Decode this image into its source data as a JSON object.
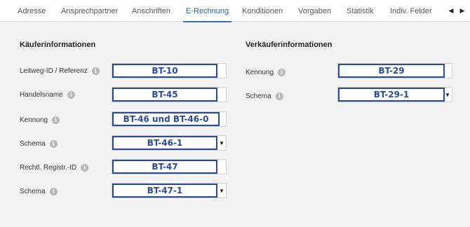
{
  "tabs": [
    {
      "label": "Adresse",
      "active": false
    },
    {
      "label": "Ansprechpartner",
      "active": false
    },
    {
      "label": "Anschriften",
      "active": false
    },
    {
      "label": "E-Rechnung",
      "active": true
    },
    {
      "label": "Konditionen",
      "active": false
    },
    {
      "label": "Vorgaben",
      "active": false
    },
    {
      "label": "Statistik",
      "active": false
    },
    {
      "label": "Indiv. Felder",
      "active": false
    }
  ],
  "tab_scroll": {
    "left": "◀",
    "right": "▶"
  },
  "buyer": {
    "title": "Käuferinformationen",
    "fields": [
      {
        "label": "Leitweg-ID / Referenz",
        "value": "BT-10",
        "type": "text"
      },
      {
        "label": "Handelsname",
        "value": "BT-45",
        "type": "text"
      },
      {
        "label": "Kennung",
        "value": "BT-46 und BT-46-0",
        "type": "text"
      },
      {
        "label": "Schema",
        "value": "BT-46-1",
        "type": "select"
      },
      {
        "label": "Rechtl. Registr.-ID",
        "value": "BT-47",
        "type": "text"
      },
      {
        "label": "Schema",
        "value": "BT-47-1",
        "type": "select"
      }
    ]
  },
  "seller": {
    "title": "Verkäuferinformationen",
    "fields": [
      {
        "label": "Kennung",
        "value": "BT-29",
        "type": "text"
      },
      {
        "label": "Schema",
        "value": "BT-29-1",
        "type": "select"
      }
    ]
  },
  "icons": {
    "info": "i",
    "dropdown": "▼"
  },
  "colors": {
    "accent": "#3b6fb6",
    "value_border": "#2a4b94"
  }
}
